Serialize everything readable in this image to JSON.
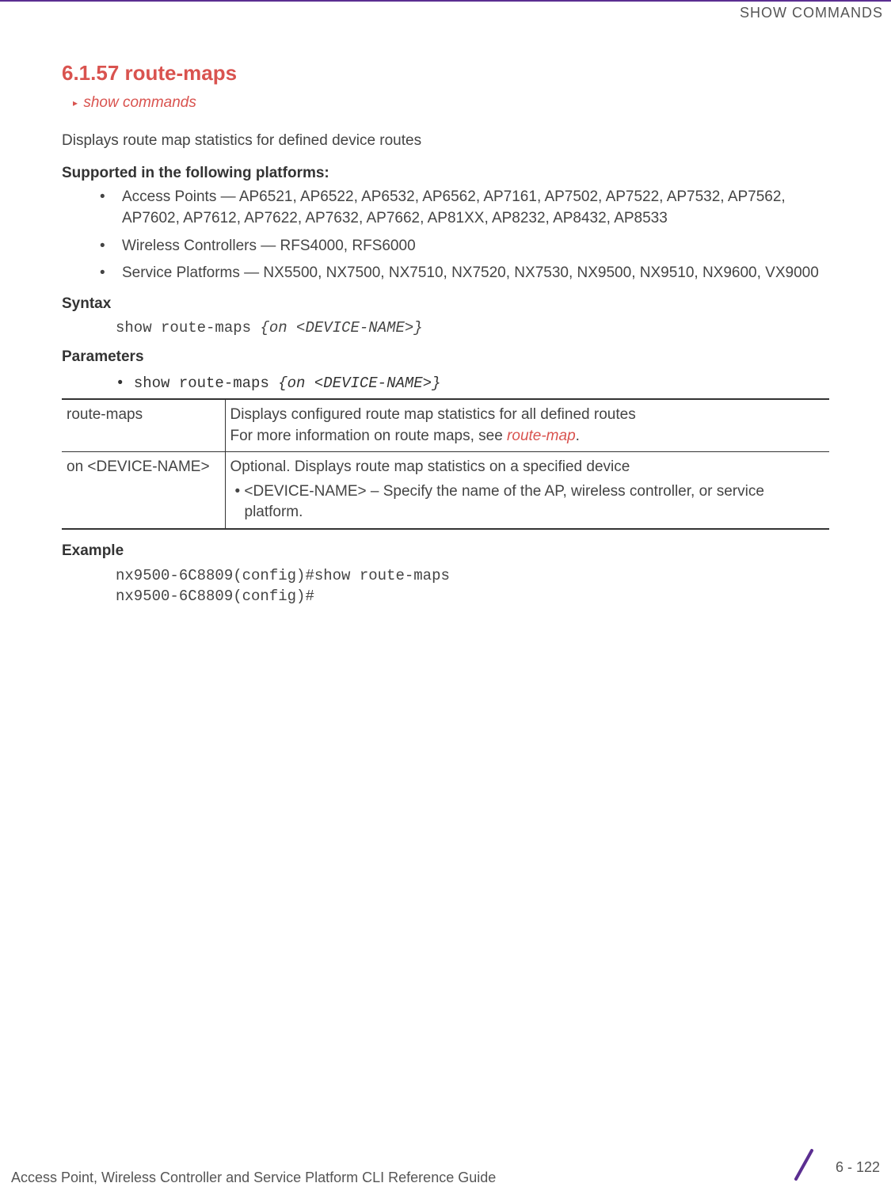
{
  "header": {
    "chapter_label": "SHOW COMMANDS"
  },
  "section": {
    "number_title": "6.1.57 route-maps",
    "breadcrumb": "show commands",
    "description": "Displays route map statistics for defined device routes"
  },
  "supported": {
    "heading": "Supported in the following platforms:",
    "items": [
      "Access Points — AP6521, AP6522, AP6532, AP6562, AP7161, AP7502, AP7522, AP7532, AP7562, AP7602, AP7612, AP7622, AP7632, AP7662, AP81XX, AP8232, AP8432, AP8533",
      "Wireless Controllers — RFS4000, RFS6000",
      "Service Platforms — NX5500, NX7500, NX7510, NX7520, NX7530, NX9500, NX9510, NX9600, VX9000"
    ]
  },
  "syntax": {
    "heading": "Syntax",
    "command_plain": "show route-maps ",
    "command_italic": "{on <DEVICE-NAME>}"
  },
  "parameters": {
    "heading": "Parameters",
    "line_bullet": "• ",
    "line_plain": "show route-maps ",
    "line_italic": "{on <DEVICE-NAME>}",
    "rows": [
      {
        "name": "route-maps",
        "desc_line1": "Displays configured route map statistics for all defined routes",
        "desc_line2_pre": "For more information on route maps, see ",
        "desc_line2_link": "route-map",
        "desc_line2_post": "."
      },
      {
        "name": "on <DEVICE-NAME>",
        "desc_line1": "Optional. Displays route map statistics on a specified device",
        "desc_bullet": "•  <DEVICE-NAME> – Specify the name of the AP, wireless controller, or service platform."
      }
    ]
  },
  "example": {
    "heading": "Example",
    "code": "nx9500-6C8809(config)#show route-maps\nnx9500-6C8809(config)#"
  },
  "footer": {
    "guide": "Access Point, Wireless Controller and Service Platform CLI Reference Guide",
    "page": "6 - 122"
  }
}
